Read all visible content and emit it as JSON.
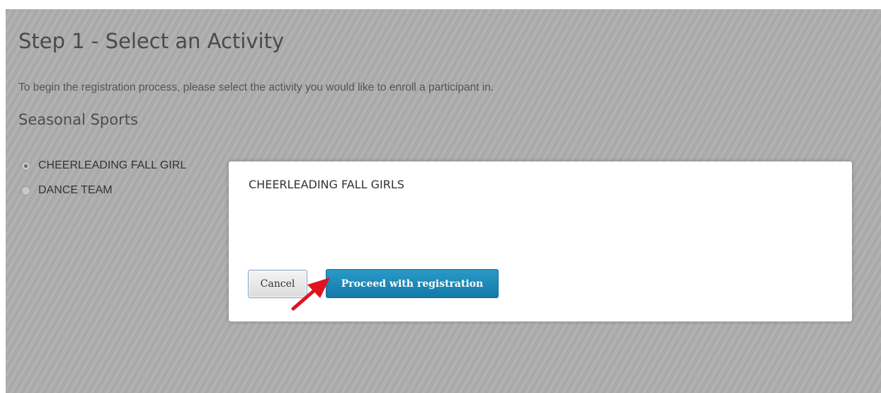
{
  "page": {
    "title": "Step 1 - Select an Activity",
    "intro": "To begin the registration process, please select the activity you would like to enroll a participant in.",
    "section_heading": "Seasonal Sports"
  },
  "activities": [
    {
      "label": "CHEERLEADING FALL GIRLS",
      "visible_label": "CHEERLEADING FALL GIRL",
      "selected": true
    },
    {
      "label": "DANCE TEAM",
      "visible_label": "DANCE TEAM",
      "selected": false
    }
  ],
  "modal": {
    "title": "CHEERLEADING FALL GIRLS",
    "cancel_label": "Cancel",
    "proceed_label": "Proceed with registration"
  },
  "colors": {
    "overlay": "#a9a9a9",
    "primary_button": "#1a86b6",
    "annotation_arrow": "#e0141e"
  },
  "icons": {
    "annotation": "red-pointer-arrow-icon"
  }
}
